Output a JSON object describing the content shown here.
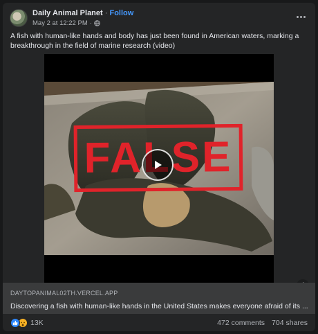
{
  "post": {
    "page_name": "Daily Animal Planet",
    "separator": "·",
    "follow_label": "Follow",
    "timestamp": "May 2 at 12:22 PM",
    "meta_separator": "·",
    "privacy_icon": "globe-icon",
    "more_icon": "more-options-icon",
    "caption": "A fish with human-like hands and body has just been found in American waters, marking a breakthrough in the field of marine research (video)"
  },
  "media": {
    "stamp_text": "FALSE",
    "stamp_color": "#e0232a",
    "play_icon": "play-icon",
    "info_icon_text": "i"
  },
  "link_preview": {
    "domain": "DAYTOPANIMAL02TH.VERCEL.APP",
    "title": "Discovering a fish with human-like hands in the United States makes everyone afraid of its ..."
  },
  "engagement": {
    "reaction_icons": [
      "like-icon",
      "wow-icon"
    ],
    "reaction_count": "13K",
    "comments": "472 comments",
    "shares": "704 shares"
  },
  "colors": {
    "background": "#18191a",
    "card": "#242526",
    "link_box": "#3a3b3c",
    "accent": "#4599ff",
    "like": "#2d88ff",
    "wow": "#f7b125"
  }
}
